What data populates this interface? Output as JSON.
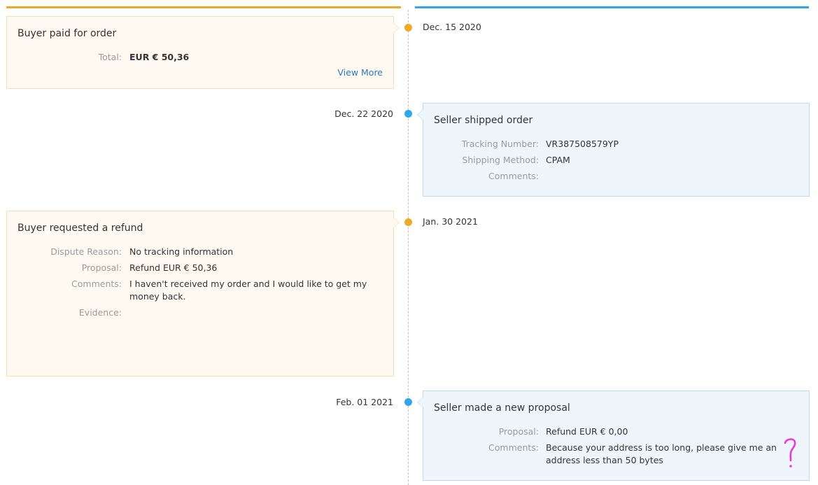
{
  "events": [
    {
      "title": "Buyer paid for order",
      "date": "Dec. 15 2020",
      "fields": [
        {
          "label": "Total:",
          "value": "EUR € 50,36"
        }
      ],
      "link": "View More"
    },
    {
      "title": "Seller shipped order",
      "date": "Dec. 22 2020",
      "fields": [
        {
          "label": "Tracking Number:",
          "value": "VR387508579YP"
        },
        {
          "label": "Shipping Method:",
          "value": "CPAM"
        },
        {
          "label": "Comments:",
          "value": ""
        }
      ]
    },
    {
      "title": "Buyer requested a refund",
      "date": "Jan. 30 2021",
      "fields": [
        {
          "label": "Dispute Reason:",
          "value": "No tracking information"
        },
        {
          "label": "Proposal:",
          "value": "Refund EUR € 50,36"
        },
        {
          "label": "Comments:",
          "value": "I haven't received my order and I would like to get my money back."
        },
        {
          "label": "Evidence:",
          "value": ""
        }
      ]
    },
    {
      "title": "Seller made a new proposal",
      "date": "Feb. 01 2021",
      "fields": [
        {
          "label": "Proposal:",
          "value": "Refund EUR € 0,00"
        },
        {
          "label": "Comments:",
          "value": "Because your address is too long, please give me an address less than 50 bytes"
        }
      ]
    }
  ],
  "colors": {
    "buyer_accent": "#f0a927",
    "seller_accent": "#2ea7ec",
    "annotation": "#e83ad8"
  },
  "annotation_icon": "question-mark-icon"
}
